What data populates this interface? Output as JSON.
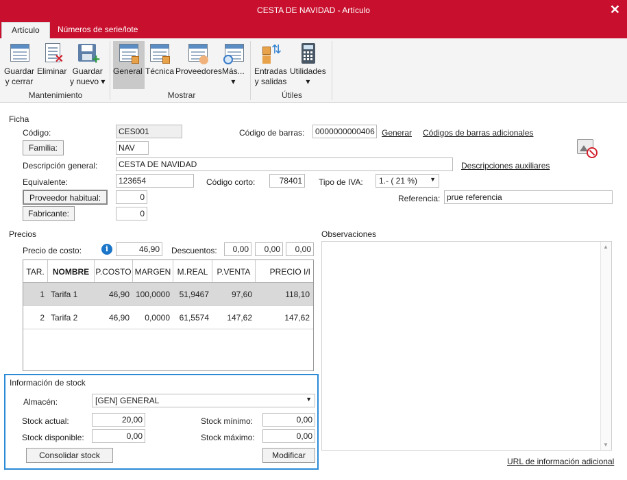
{
  "window": {
    "title": "CESTA DE NAVIDAD - Artículo",
    "close_glyph": "✕"
  },
  "tabs": [
    {
      "label": "Artículo",
      "active": true
    },
    {
      "label": "Números de serie/lote",
      "active": false
    }
  ],
  "ribbon": {
    "buttons": {
      "guardar_cerrar": "Guardar\ny cerrar",
      "eliminar": "Eliminar",
      "guardar_nuevo": "Guardar\ny nuevo ▾",
      "general": "General",
      "tecnica": "Técnica",
      "proveedores": "Proveedores",
      "mas": "Más...\n▾",
      "entradas_salidas": "Entradas\ny salidas",
      "utilidades": "Utilidades\n▾"
    },
    "groups": {
      "mantenimiento": "Mantenimiento",
      "mostrar": "Mostrar",
      "utiles": "Útiles"
    }
  },
  "ficha": {
    "section": "Ficha",
    "codigo_label": "Código:",
    "codigo_value": "CES001",
    "familia_button": "Familia:",
    "familia_value": "NAV",
    "descripcion_label": "Descripción general:",
    "descripcion_value": "CESTA DE NAVIDAD",
    "equivalente_label": "Equivalente:",
    "equivalente_value": "123654",
    "proveedor_button": "Proveedor habitual:",
    "proveedor_value": "0",
    "fabricante_button": "Fabricante:",
    "fabricante_value": "0",
    "codigo_barras_label": "Código de barras:",
    "codigo_barras_value": "0000000000406",
    "generar_link": "Generar",
    "codigos_adicionales_link": "Códigos de barras adicionales",
    "descripciones_aux_link": "Descripciones auxiliares",
    "codigo_corto_label": "Código corto:",
    "codigo_corto_value": "78401",
    "tipo_iva_label": "Tipo de IVA:",
    "tipo_iva_value": "1.- ( 21 %)",
    "referencia_label": "Referencia:",
    "referencia_value": "prue referencia"
  },
  "precios": {
    "section": "Precios",
    "precio_costo_label": "Precio de costo:",
    "precio_costo_value": "46,90",
    "descuentos_label": "Descuentos:",
    "descuentos": [
      "0,00",
      "0,00",
      "0,00"
    ],
    "columns": [
      "TAR.",
      "NOMBRE",
      "P.COSTO",
      "MARGEN",
      "M.REAL",
      "P.VENTA",
      "PRECIO I/I"
    ],
    "rows": [
      {
        "tar": "1",
        "nombre": "Tarifa 1",
        "pcosto": "46,90",
        "margen": "100,0000",
        "mreal": "51,9467",
        "pventa": "97,60",
        "precio_ii": "118,10"
      },
      {
        "tar": "2",
        "nombre": "Tarifa 2",
        "pcosto": "46,90",
        "margen": "0,0000",
        "mreal": "61,5574",
        "pventa": "147,62",
        "precio_ii": "147,62"
      }
    ]
  },
  "stock": {
    "section": "Información de stock",
    "almacen_label": "Almacén:",
    "almacen_value": "[GEN] GENERAL",
    "stock_actual_label": "Stock actual:",
    "stock_actual_value": "20,00",
    "stock_disponible_label": "Stock disponible:",
    "stock_disponible_value": "0,00",
    "stock_minimo_label": "Stock mínimo:",
    "stock_minimo_value": "0,00",
    "stock_maximo_label": "Stock máximo:",
    "stock_maximo_value": "0,00",
    "consolidar_button": "Consolidar stock",
    "modificar_button": "Modificar"
  },
  "observaciones": {
    "section": "Observaciones",
    "url_link": "URL de información adicional"
  },
  "colors": {
    "accent": "#c8102e",
    "stock_border": "#2a8ad6",
    "selected_row": "#d9d9d9"
  }
}
